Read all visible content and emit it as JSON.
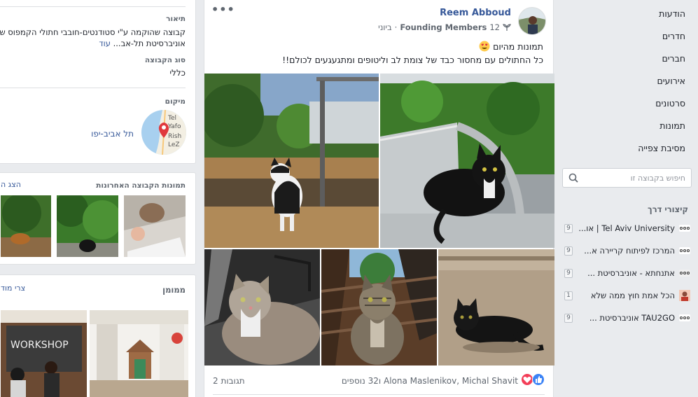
{
  "nav": {
    "items": [
      {
        "name": "nav-item-discussion",
        "label": "הודעות"
      },
      {
        "name": "nav-item-rooms",
        "label": "חדרים"
      },
      {
        "name": "nav-item-members",
        "label": "חברים"
      },
      {
        "name": "nav-item-events",
        "label": "אירועים"
      },
      {
        "name": "nav-item-videos",
        "label": "סרטונים"
      },
      {
        "name": "nav-item-photos",
        "label": "תמונות"
      },
      {
        "name": "nav-item-watch-party",
        "label": "מסיבת צפייה"
      }
    ],
    "search_placeholder": "חיפוש בקבוצה זו",
    "shortcuts_title": "קיצורי דרך",
    "shortcuts": [
      {
        "label": "Tel Aviv University | או...",
        "count": "9",
        "icon": "dots-icon"
      },
      {
        "label": "המרכז לפיתוח קריירה א...",
        "count": "9",
        "icon": "dots-icon"
      },
      {
        "label": "אתנחתא - אוניברסיטת ...",
        "count": "9",
        "icon": "dots-icon"
      },
      {
        "label": "הכל אמת חוץ ממה שלא",
        "count": "1",
        "icon": "photo-icon"
      },
      {
        "label": "TAU2GO אוניברסיטת ...",
        "count": "9",
        "icon": "dots-icon"
      }
    ]
  },
  "post": {
    "author": "Reem Abboud",
    "badge_count": "12",
    "badge": "Founding Members",
    "date": "ביוני",
    "text_line1": "תמונות מהיום",
    "text_line2": "כל החתולים עם מחסור כבד של צומת לב וליטופים ומתגעגעים לכולם!!",
    "reactors": "Alona Maslenikov, Michal Shavit ו32 נוספים",
    "comments": "2 תגובות",
    "colors": {
      "author": "#365899",
      "like": "#3b83f6",
      "love": "#f33e58"
    }
  },
  "left": {
    "description_label": "תיאור",
    "description_line1": "קבוצה שהוקמה ע\"י סטודנטים-חובבי חתולי הקמפוס ש",
    "description_line2": "אוניברסיטת תל-אב...",
    "see_more": "עוד",
    "group_type_label": "סוג הקבוצה",
    "group_type": "כללי",
    "location_label": "מיקום",
    "location": "תל אביב-יפו",
    "map_text": [
      "Tel",
      "Yafo",
      "Rish",
      "LeZ"
    ],
    "recent_photos_label": "תמונות הקבוצה האחרונות",
    "see_all": "הצג ה",
    "sponsored_label": "ממומן",
    "create_ad": "צרי מוד",
    "ad_text": "WORKSHOP"
  }
}
